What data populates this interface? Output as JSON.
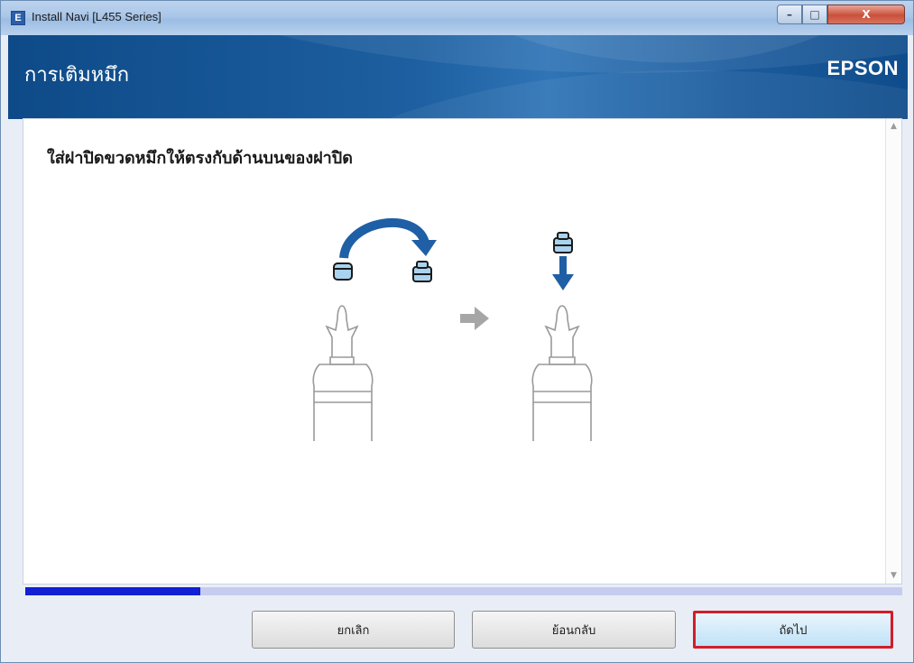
{
  "window": {
    "title": "Install Navi [L455 Series]",
    "icon_letter": "E",
    "controls": {
      "minimize": "–",
      "maximize": "□",
      "close": "X"
    }
  },
  "header": {
    "title": "การเติมหมึก",
    "brand": "EPSON"
  },
  "content": {
    "instruction": "ใส่ฝาปิดขวดหมึกให้ตรงกับด้านบนของฝาปิด",
    "illustration": {
      "icons": [
        "curved-arrow-icon",
        "bottle-cap-icon",
        "ink-bottle-icon",
        "right-arrow-icon",
        "down-arrow-icon"
      ]
    },
    "scrollbar": {
      "up": "▲",
      "down": "▼"
    }
  },
  "progress": {
    "fraction": 0.2
  },
  "buttons": {
    "cancel": "ยกเลิก",
    "back": "ย้อนกลับ",
    "next": "ถัดไป"
  },
  "colors": {
    "header_blue": "#1d5fa0",
    "progress_fill": "#1020d2",
    "progress_track": "#c6ccef",
    "highlight_red": "#d21d2b",
    "illustration_blue": "#1f5fa5",
    "cap_light_blue": "#a9d3ee"
  }
}
